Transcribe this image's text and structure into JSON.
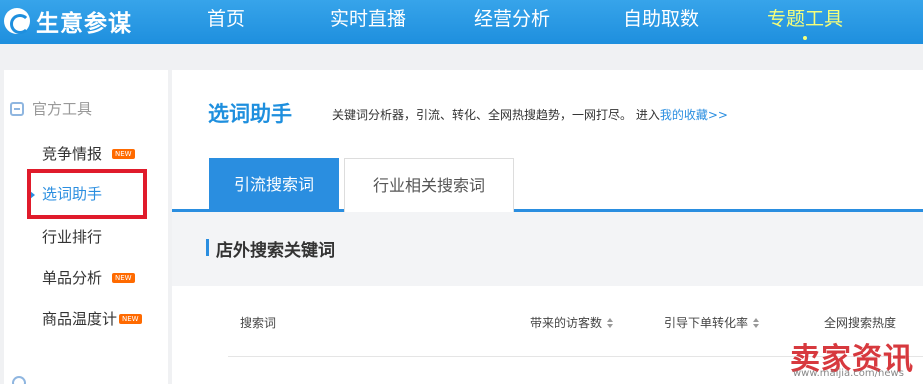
{
  "topbar": {
    "logo_text": "生意参谋",
    "nav": [
      "首页",
      "实时直播",
      "经营分析",
      "自助取数",
      "专题工具"
    ],
    "active_index": 4,
    "background": "#1e8fde",
    "active_color": "#f6ff7a"
  },
  "sidebar": {
    "group_label": "官方工具",
    "items": [
      {
        "label": "竞争情报",
        "badge": "NEW"
      },
      {
        "label": "选词助手",
        "active": true
      },
      {
        "label": "行业排行"
      },
      {
        "label": "单品分析",
        "badge": "NEW"
      },
      {
        "label": "商品温度计",
        "badge": "NEW"
      }
    ],
    "highlight_color": "#e01b2b"
  },
  "main": {
    "title": "选词助手",
    "description": "关键词分析器，引流、转化、全网热搜趋势，一网打尽。 进入",
    "description_link": "我的收藏>>",
    "tabs": [
      "引流搜索词",
      "行业相关搜索词"
    ],
    "section_title": "店外搜索关键词",
    "columns": [
      "搜索词",
      "带来的访客数",
      "引导下单转化率",
      "全网搜索热度"
    ],
    "accent_color": "#2a8ee0"
  },
  "watermark": {
    "title": "卖家资讯",
    "url": "www.maijia.com/news"
  }
}
